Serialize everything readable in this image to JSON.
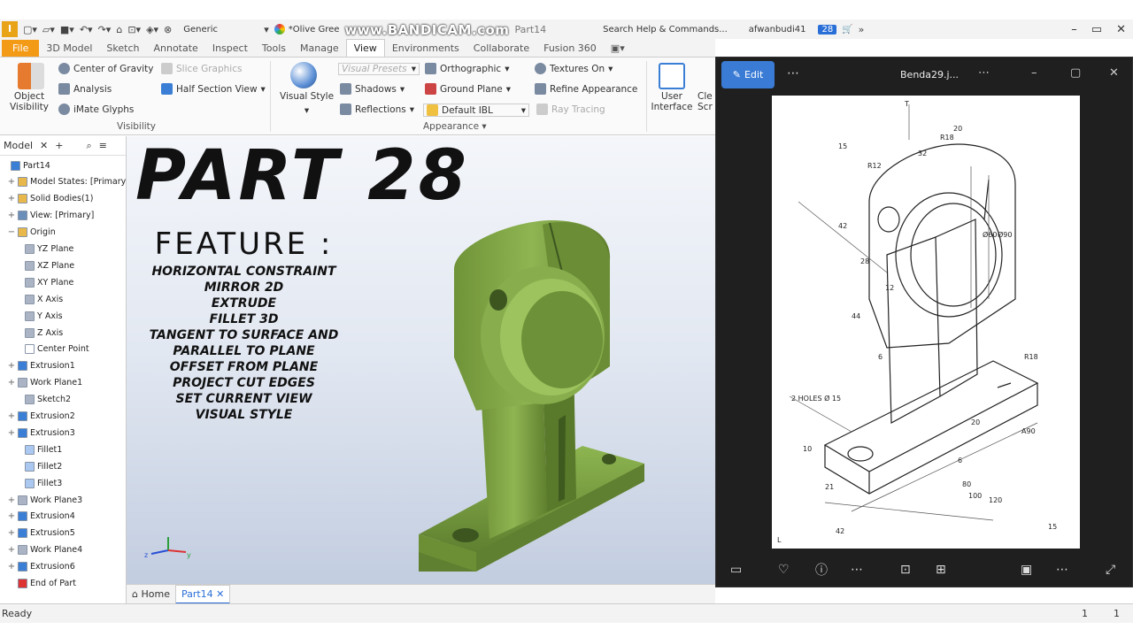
{
  "title_bar": {
    "app_badge": "I",
    "appearance_combo": "Generic",
    "material_combo": "*Olive Gree",
    "watermark": "www.BANDICAM.com",
    "doc_name": "Part14",
    "search": "Search Help & Commands...",
    "user": "afwanbudi41",
    "timer": "28",
    "window_controls": [
      "–",
      "▭",
      "✕"
    ]
  },
  "ribbon_tabs": [
    "File",
    "3D Model",
    "Sketch",
    "Annotate",
    "Inspect",
    "Tools",
    "Manage",
    "View",
    "Environments",
    "Collaborate",
    "Fusion 360"
  ],
  "active_tab": "View",
  "ribbon": {
    "visibility": {
      "object_visibility": "Object Visibility",
      "center_of_gravity": "Center of Gravity",
      "slice_graphics": "Slice Graphics",
      "analysis": "Analysis",
      "half_section_view": "Half Section View",
      "imate_glyphs": "iMate Glyphs",
      "group_label": "Visibility"
    },
    "appearance": {
      "visual_style": "Visual Style",
      "visual_presets": "Visual Presets",
      "orthographic": "Orthographic",
      "textures_on": "Textures On",
      "shadows": "Shadows",
      "ground_plane": "Ground Plane",
      "refine_appearance": "Refine Appearance",
      "reflections": "Reflections",
      "default_ibl": "Default IBL",
      "ray_tracing": "Ray Tracing",
      "group_label": "Appearance"
    },
    "windows": {
      "user_interface": "User Interface",
      "clean_screen": "Cle Scr"
    }
  },
  "browser": {
    "tab": "Model",
    "items": [
      {
        "label": "Part14",
        "pm": "",
        "icon": "#3a7fd5"
      },
      {
        "label": "Model States: [Primary]",
        "pm": "+",
        "icon": "#e8b84a"
      },
      {
        "label": "Solid Bodies(1)",
        "pm": "+",
        "icon": "#e8b84a"
      },
      {
        "label": "View: [Primary]",
        "pm": "+",
        "icon": "#6a8fb8"
      },
      {
        "label": "Origin",
        "pm": "−",
        "icon": "#e8b84a"
      },
      {
        "label": "YZ Plane",
        "pm": "",
        "icon": "#aab4c4"
      },
      {
        "label": "XZ Plane",
        "pm": "",
        "icon": "#aab4c4"
      },
      {
        "label": "XY Plane",
        "pm": "",
        "icon": "#aab4c4"
      },
      {
        "label": "X Axis",
        "pm": "",
        "icon": "#aab4c4"
      },
      {
        "label": "Y Axis",
        "pm": "",
        "icon": "#aab4c4"
      },
      {
        "label": "Z Axis",
        "pm": "",
        "icon": "#aab4c4"
      },
      {
        "label": "Center Point",
        "pm": "",
        "icon": "#ffffff"
      },
      {
        "label": "Extrusion1",
        "pm": "+",
        "icon": "#3a7fd5"
      },
      {
        "label": "Work Plane1",
        "pm": "+",
        "icon": "#aab4c4"
      },
      {
        "label": "Sketch2",
        "pm": "",
        "icon": "#aab4c4"
      },
      {
        "label": "Extrusion2",
        "pm": "+",
        "icon": "#3a7fd5"
      },
      {
        "label": "Extrusion3",
        "pm": "+",
        "icon": "#3a7fd5"
      },
      {
        "label": "Fillet1",
        "pm": "",
        "icon": "#aac8f0"
      },
      {
        "label": "Fillet2",
        "pm": "",
        "icon": "#aac8f0"
      },
      {
        "label": "Fillet3",
        "pm": "",
        "icon": "#aac8f0"
      },
      {
        "label": "Work Plane3",
        "pm": "+",
        "icon": "#aab4c4"
      },
      {
        "label": "Extrusion4",
        "pm": "+",
        "icon": "#3a7fd5"
      },
      {
        "label": "Extrusion5",
        "pm": "+",
        "icon": "#3a7fd5"
      },
      {
        "label": "Work Plane4",
        "pm": "+",
        "icon": "#aab4c4"
      },
      {
        "label": "Extrusion6",
        "pm": "+",
        "icon": "#3a7fd5"
      },
      {
        "label": "End of Part",
        "pm": "",
        "icon": "#d33"
      }
    ]
  },
  "overlay": {
    "title": "PART 28",
    "feature_heading": "FEATURE :",
    "features": [
      "HORIZONTAL CONSTRAINT",
      "MIRROR 2D",
      "EXTRUDE",
      "FILLET 3D",
      "TANGENT TO SURFACE AND",
      "PARALLEL TO PLANE",
      "OFFSET FROM PLANE",
      "PROJECT CUT EDGES",
      "SET CURRENT VIEW",
      "VISUAL STYLE"
    ]
  },
  "model_color": "#7fa345",
  "doc_tabs": {
    "home": "Home",
    "part": "Part14"
  },
  "status": {
    "text": "Ready",
    "n1": "1",
    "n2": "1"
  },
  "photos": {
    "edit": "Edit",
    "filename": "Benda29.j...",
    "drawing": {
      "holes_note": "2 HOLES Ø 15",
      "dims": [
        "T",
        "15",
        "R18",
        "20",
        "R12",
        "42",
        "28",
        "12",
        "32",
        "Ø60",
        "Ø90",
        "44",
        "6",
        "R18",
        "20",
        "A90",
        "10",
        "21",
        "6",
        "80",
        "100",
        "120",
        "42",
        "L",
        "15"
      ]
    }
  }
}
